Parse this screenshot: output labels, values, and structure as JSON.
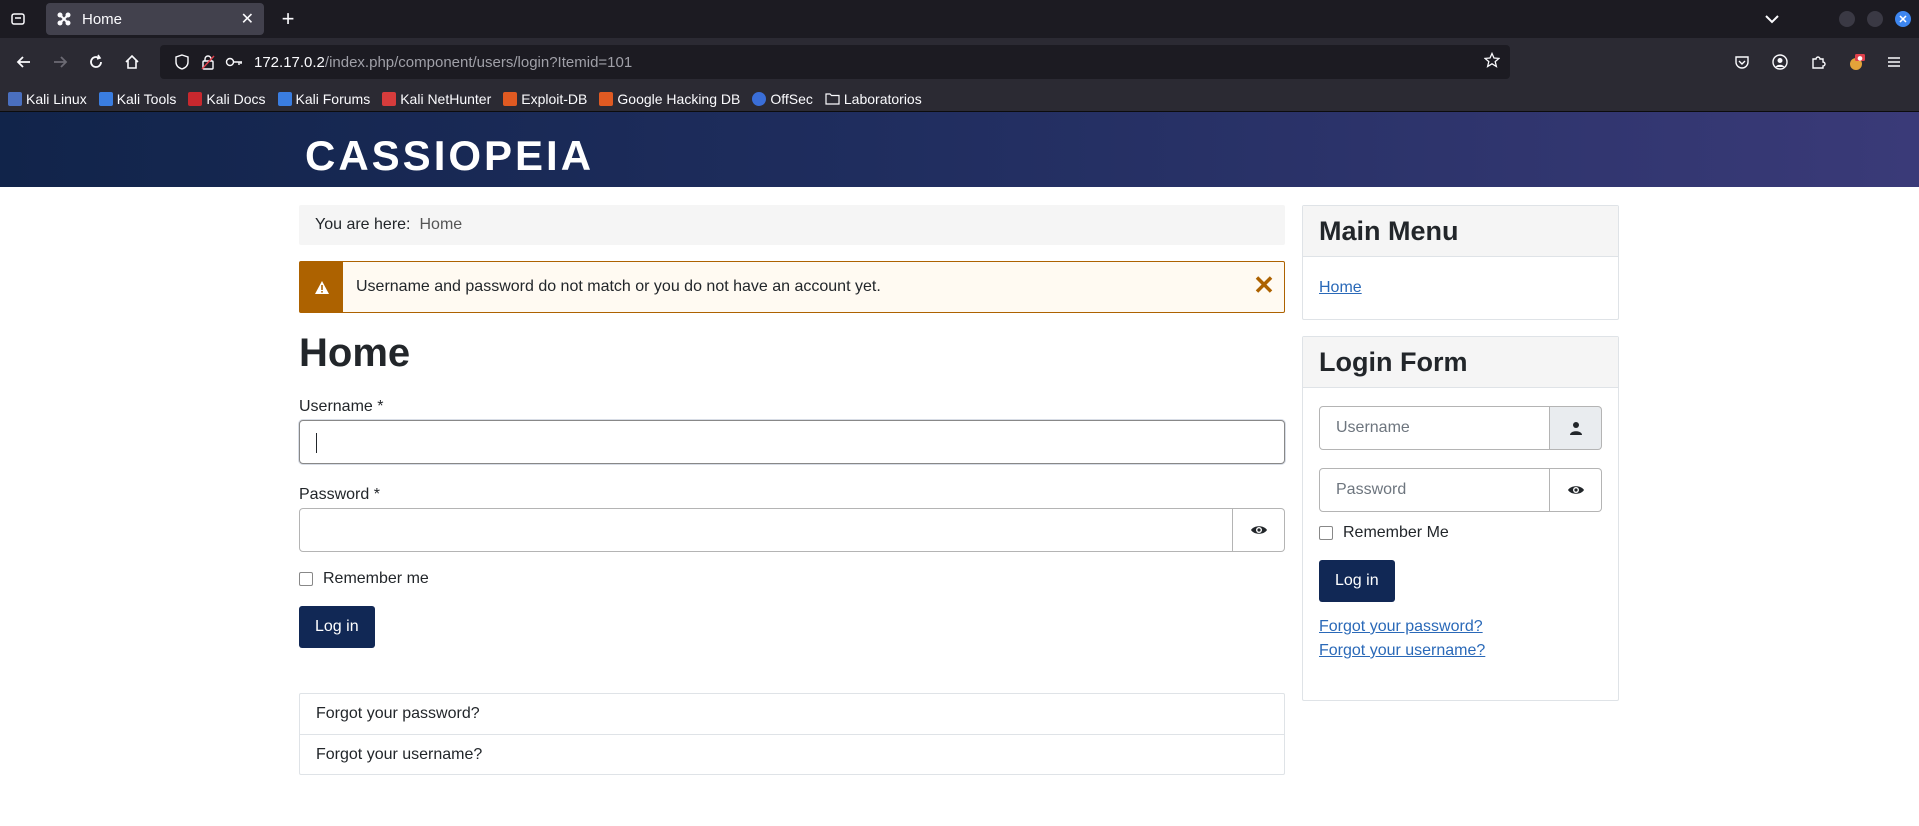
{
  "browser": {
    "tab_title": "Home",
    "url_host": "172.17.0.2",
    "url_path": "/index.php/component/users/login?Itemid=101",
    "bookmarks": [
      {
        "label": "Kali Linux",
        "color": "#5b7fd8"
      },
      {
        "label": "Kali Tools",
        "color": "#3a7de0"
      },
      {
        "label": "Kali Docs",
        "color": "#c8282e"
      },
      {
        "label": "Kali Forums",
        "color": "#3a7de0"
      },
      {
        "label": "Kali NetHunter",
        "color": "#d63c3c"
      },
      {
        "label": "Exploit-DB",
        "color": "#e05a22"
      },
      {
        "label": "Google Hacking DB",
        "color": "#e05a22"
      },
      {
        "label": "OffSec",
        "color": "#3a6ed8"
      },
      {
        "label": "Laboratorios",
        "color": "folder"
      }
    ]
  },
  "site": {
    "brand": "CASSIOPEIA",
    "breadcrumb_prefix": "You are here:",
    "breadcrumb_current": "Home",
    "alert_message": "Username and password do not match or you do not have an account yet.",
    "page_title": "Home",
    "username_label": "Username *",
    "password_label": "Password *",
    "remember_label": "Remember me",
    "login_button": "Log in",
    "forgot_password": "Forgot your password?",
    "forgot_username": "Forgot your username?"
  },
  "sidebar": {
    "menu_title": "Main Menu",
    "menu_items": [
      "Home"
    ],
    "login_title": "Login Form",
    "username_placeholder": "Username",
    "password_placeholder": "Password",
    "remember_label": "Remember Me",
    "login_button": "Log in",
    "forgot_password": "Forgot your password?",
    "forgot_username": "Forgot your username?"
  },
  "colors": {
    "accent": "#112855",
    "warning": "#ad6200",
    "link": "#2a69b8"
  }
}
